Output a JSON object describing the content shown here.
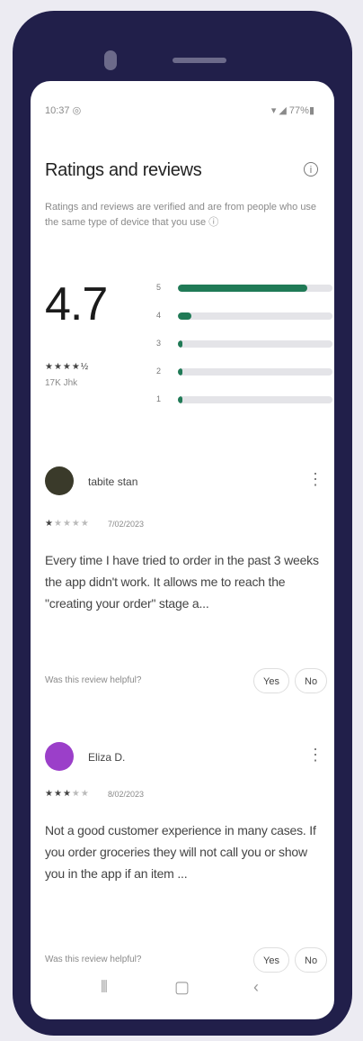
{
  "status": {
    "time": "10:37 ◎",
    "icons": "▾ ◢ 77%▮"
  },
  "header": {
    "title": "Ratings and reviews",
    "info_icon": "ⓘ"
  },
  "description": "Ratings and reviews are verified and are from people who use the same type of device that you use ⓘ",
  "summary": {
    "score": "4.7",
    "stars": "★★★★½",
    "count": "17K Jhk",
    "distribution": [
      {
        "star": "5",
        "fraction": 0.84
      },
      {
        "star": "4",
        "fraction": 0.09
      },
      {
        "star": "3",
        "fraction": 0.03
      },
      {
        "star": "2",
        "fraction": 0.03
      },
      {
        "star": "1",
        "fraction": 0.03
      }
    ]
  },
  "reviews": [
    {
      "name": "tabite stan",
      "rating": 1,
      "stars": "★★★★★",
      "date": "7/02/2023",
      "text": "Every time I have tried to order in the past 3 weeks the app didn't work. It allows me to reach the \"creating your order\" stage a...",
      "helpful_prompt": "Was this review helpful?",
      "yes_label": "Yes",
      "no_label": "No",
      "avatar_color": "#3a3a2a"
    },
    {
      "name": "Eliza D.",
      "rating": 3,
      "stars": "★★★★★",
      "date": "8/02/2023",
      "text": "Not a good customer experience in many cases. If you order groceries they will not call you or show you in the app if an item ...",
      "helpful_prompt": "Was this review helpful?",
      "yes_label": "Yes",
      "no_label": "No",
      "avatar_color": "#9b3fc9"
    }
  ],
  "more_icon": "⋮",
  "nav": {
    "recents": "⦀",
    "home": "▢",
    "back": "‹"
  }
}
